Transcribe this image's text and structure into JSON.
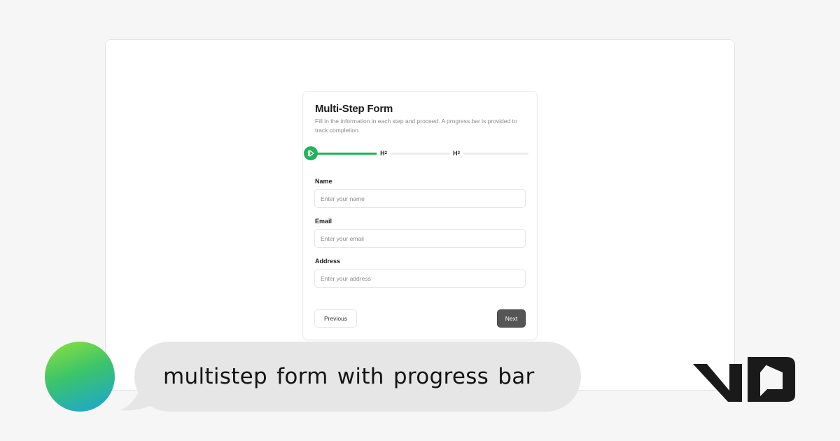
{
  "form": {
    "title": "Multi-Step Form",
    "description": "Fill in the information in each step and proceed. A progress bar is provided to track completion.",
    "progress": {
      "fraction": 0.33,
      "steps": [
        {
          "icon": "play-icon",
          "state": "active"
        },
        {
          "label": "H",
          "sub": "2",
          "state": "pending"
        },
        {
          "label": "H",
          "sub": "3",
          "state": "pending"
        }
      ]
    },
    "fields": [
      {
        "label": "Name",
        "placeholder": "Enter your name"
      },
      {
        "label": "Email",
        "placeholder": "Enter your email"
      },
      {
        "label": "Address",
        "placeholder": "Enter your address"
      }
    ],
    "buttons": {
      "previous": "Previous",
      "next": "Next"
    }
  },
  "prompt": {
    "text": "multistep form with progress bar"
  },
  "colors": {
    "progress_fill": "#22b35a",
    "next_button": "#555555",
    "bubble": "#e6e6e6"
  },
  "logo": {
    "icon": "v0-logo"
  }
}
